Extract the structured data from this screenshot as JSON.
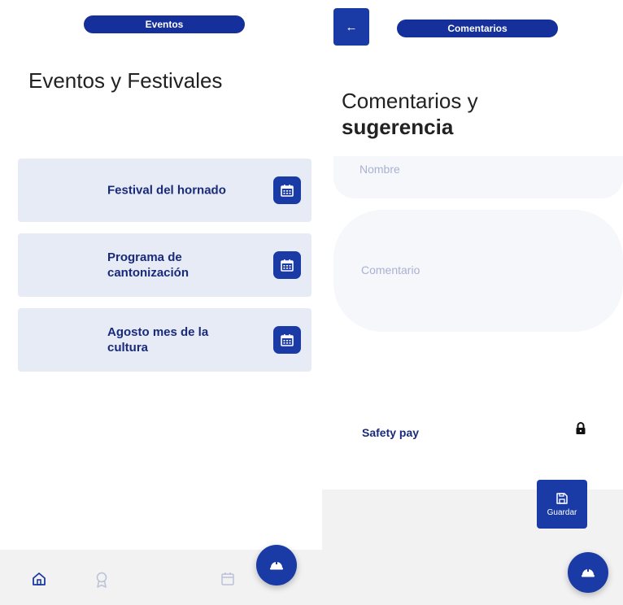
{
  "left": {
    "header_title": "Eventos",
    "heading": "Eventos y Festivales",
    "events": [
      {
        "label": "Festival del hornado"
      },
      {
        "label": "Programa de cantonización"
      },
      {
        "label": "Agosto mes de la cultura"
      }
    ],
    "nav": {
      "items": [
        {
          "icon": "home-icon"
        },
        {
          "icon": "award-icon"
        },
        {
          "icon": "calendar-icon"
        }
      ]
    },
    "fab_icon": "helmet-icon"
  },
  "right": {
    "header_title": "Comentarios",
    "back_icon": "arrow-left-icon",
    "back_glyph": "←",
    "heading_line1": "Comentarios y",
    "heading_line2": "sugerencia",
    "name_placeholder": "Nombre",
    "comment_placeholder": "Comentario",
    "safety_label": "Safety pay",
    "safety_icon": "lock-icon",
    "save_label": "Guardar",
    "fab_icon": "helmet-icon"
  },
  "colors": {
    "primary": "#1a3aa5",
    "header_pill": "#15309a",
    "card_bg": "#e6ebf6",
    "card_text": "#1a2a7a",
    "placeholder": "#a7b2d4",
    "nav_bg": "#f2f2f2"
  }
}
